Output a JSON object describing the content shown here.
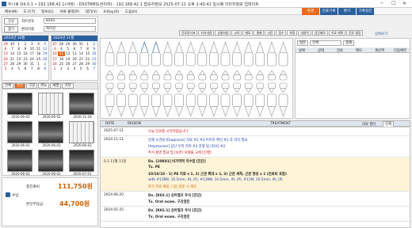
{
  "window": {
    "title": "두나로 D4.0.1 • 192.168.42.1(서버) - DSSTRMS(관리자) - 192.168.42.1 접속자정보 2025-07-11 오후 2:40:41 일시폐 이미지정보 업데이트"
  },
  "menu": [
    "메뉴(M)",
    "도구(T)",
    "정보(G)",
    "서류 출력(P)",
    "대기(V)",
    "X-Ray(X)",
    "도움(H)"
  ],
  "right_tabs": [
    "환경",
    "진료기록",
    "환기",
    "기록검진"
  ],
  "patient": {
    "btn1": "신규",
    "btn2": "찾기",
    "label1": "차트번호",
    "value1": "8343",
    "label2": "환자이름",
    "value2": "최하진",
    "badge": "X-RAY"
  },
  "calendars": [
    {
      "header": "2024년 10월",
      "weeks": [
        [
          "29",
          "30",
          "1",
          "2",
          "3",
          "4",
          "5"
        ],
        [
          "6",
          "7",
          "8",
          "9",
          "10",
          "11",
          "12"
        ],
        [
          "13",
          "14",
          "15",
          "16",
          "17",
          "18",
          "19"
        ],
        [
          "20",
          "21",
          "22",
          "23",
          "24",
          "25",
          "26"
        ],
        [
          "27",
          "28",
          "29",
          "30",
          "31",
          "1",
          "2"
        ],
        [
          "3",
          "4",
          "5",
          "6",
          "7",
          "8",
          "9"
        ]
      ]
    },
    {
      "header": "2024년 11월",
      "weeks": [
        [
          "27",
          "28",
          "29",
          "30",
          "31",
          "1",
          "2"
        ],
        [
          "3",
          "4",
          "5",
          "6",
          "7",
          "8",
          "9"
        ],
        [
          "10",
          "11",
          "12",
          "13",
          "14",
          "15",
          "16"
        ],
        [
          "17",
          "18",
          "19",
          "20",
          "21",
          "22",
          "23"
        ],
        [
          "24",
          "25",
          "26",
          "27",
          "28",
          "29",
          "30"
        ],
        [
          "1",
          "2",
          "3",
          "4",
          "5",
          "6",
          "7"
        ]
      ]
    }
  ],
  "image_tabs": [
    "전체",
    "영상",
    "구강",
    "파노",
    "세팔",
    "기타"
  ],
  "thumbs": [
    {
      "date": "2020-06-02"
    },
    {
      "date": "2020-06-02"
    },
    {
      "date": "2020-11-26"
    },
    {
      "date": "2020-06-02"
    },
    {
      "date": "2020-06-02"
    },
    {
      "date": "2020-06-02"
    },
    {
      "date": "2020-06-02"
    },
    {
      "date": "2020-06-02"
    },
    {
      "date": "2020-07-01"
    }
  ],
  "totals": {
    "label1": "총진료비",
    "value1": "111,750원",
    "label2": "수납",
    "label3": "본인부담금",
    "value2": "44,700원"
  },
  "toolbar": [
    "진료양식표",
    "처치내용",
    "상병처방",
    "교육",
    "메모",
    "결제",
    "사진",
    "접수",
    "최정",
    "내원력",
    "검진메모",
    "치료 계획",
    "진료 결정"
  ],
  "side_panel": {
    "title": "상태보기",
    "row1": [
      "방문",
      "전체",
      "결제"
    ],
    "cols": [
      "날짜",
      "상태",
      "진료",
      "메모",
      "계산액",
      "다음예약"
    ]
  },
  "chart_header": {
    "date": "DATE",
    "region": "REGION",
    "treatment": "TREATMENT",
    "filter_label": "의료 필터",
    "filter_value": "전체"
  },
  "rows": [
    {
      "date": "2025-07-11",
      "lines": [
        {
          "t": "오늘 진료를 시작하였습니다.",
          "c": "red"
        }
      ]
    },
    {
      "date": "2024-11-11",
      "lines": [
        {
          "t": "현재 소견내 [Diagnosis] 치료 #2 #3 이미지 확인 #1 후 처치 필요",
          "c": "blue"
        },
        {
          "t": "[Impression] 상단 우측 치아 #3 관찰 됨 [검사] #2",
          "c": "blue"
        },
        {
          "t": "추가 촬영 필요 및 [보존] 보철물 교체 [진행]",
          "c": "red"
        }
      ]
    },
    {
      "date": "0.1 11월 11일",
      "lines": [
        {
          "t": "Dx.  [10K01] 비가역적 치수염 [진단]",
          "c": "dark"
        },
        {
          "t": "Tx.  PE",
          "c": "dark"
        },
        {
          "t": "10/10/10 - 1) PE 치료 x 1, 2) 근관 확대 x 1, 3) 근관 세척, 근관 형성 x 1 (진료비 포함)",
          "c": "dark"
        },
        {
          "t": "with #13M8, 10.5mm, #L (P), #13M8, 10.5mm, #L (P), #11M, 10.5mm, #L (P)",
          "c": "blue"
        },
        {
          "t": "추가 치료 예정, 다음 방문 시 계속",
          "c": "orange"
        }
      ]
    },
    {
      "date": "2024-06-20",
      "lines": [
        {
          "t": "Dx.  [K02.1] 상아질의 우식 [진단]",
          "c": "dark"
        },
        {
          "t": "Tx.  Oral exam.    구강검진",
          "c": "dark"
        }
      ]
    },
    {
      "date": "2024-01-25",
      "lines": [
        {
          "t": "Dx.  [K02.1] 상아질의 우식 [진단]",
          "c": "dark"
        },
        {
          "t": "Tx.  Oral exam.    구강검진",
          "c": "dark"
        }
      ]
    }
  ]
}
